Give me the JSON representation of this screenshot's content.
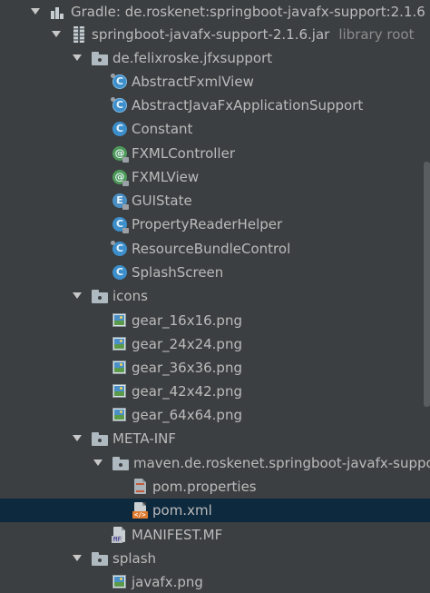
{
  "tree": {
    "root": {
      "label": "Gradle: de.roskenet:springboot-javafx-support:2.1.6",
      "icon": "gradle-library-icon"
    },
    "jar": {
      "label": "springboot-javafx-support-2.1.6.jar",
      "hint": "library root",
      "icon": "jar-archive-icon"
    },
    "package": {
      "label": "de.felixroske.jfxsupport",
      "icon": "package-folder-icon"
    },
    "classes": [
      {
        "label": "AbstractFxmlView",
        "icon": "abstract-class-icon",
        "glyph": "C"
      },
      {
        "label": "AbstractJavaFxApplicationSupport",
        "icon": "abstract-class-icon",
        "glyph": "C"
      },
      {
        "label": "Constant",
        "icon": "class-icon",
        "glyph": "C"
      },
      {
        "label": "FXMLController",
        "icon": "annotation-icon",
        "glyph": "@"
      },
      {
        "label": "FXMLView",
        "icon": "annotation-icon",
        "glyph": "@"
      },
      {
        "label": "GUIState",
        "icon": "enum-icon",
        "glyph": "E"
      },
      {
        "label": "PropertyReaderHelper",
        "icon": "class-icon",
        "glyph": "C"
      },
      {
        "label": "ResourceBundleControl",
        "icon": "class-icon",
        "glyph": "C"
      },
      {
        "label": "SplashScreen",
        "icon": "class-icon",
        "glyph": "C"
      }
    ],
    "icons_folder": {
      "label": "icons",
      "icon": "folder-icon"
    },
    "images": [
      {
        "label": "gear_16x16.png",
        "icon": "image-file-icon"
      },
      {
        "label": "gear_24x24.png",
        "icon": "image-file-icon"
      },
      {
        "label": "gear_36x36.png",
        "icon": "image-file-icon"
      },
      {
        "label": "gear_42x42.png",
        "icon": "image-file-icon"
      },
      {
        "label": "gear_64x64.png",
        "icon": "image-file-icon"
      }
    ],
    "meta_inf": {
      "label": "META-INF",
      "icon": "folder-icon"
    },
    "maven_folder": {
      "label": "maven.de.roskenet.springboot-javafx-support",
      "icon": "folder-icon"
    },
    "pom_properties": {
      "label": "pom.properties",
      "icon": "properties-file-icon"
    },
    "pom_xml": {
      "label": "pom.xml",
      "icon": "xml-file-icon",
      "badge": "</>",
      "selected": true
    },
    "manifest": {
      "label": "MANIFEST.MF",
      "icon": "manifest-file-icon",
      "badge": "MF"
    },
    "splash_folder": {
      "label": "splash",
      "icon": "folder-icon"
    },
    "splash_image": {
      "label": "javafx.png",
      "icon": "image-file-icon"
    }
  },
  "colors": {
    "background": "#3c3f41",
    "text": "#bbbbbb",
    "hint_text": "#8c8c8c",
    "selection": "#0d293e",
    "class_icon": "#3d8fcc",
    "annotation_icon": "#4e9a5a",
    "folder_icon": "#aeb9c0"
  }
}
